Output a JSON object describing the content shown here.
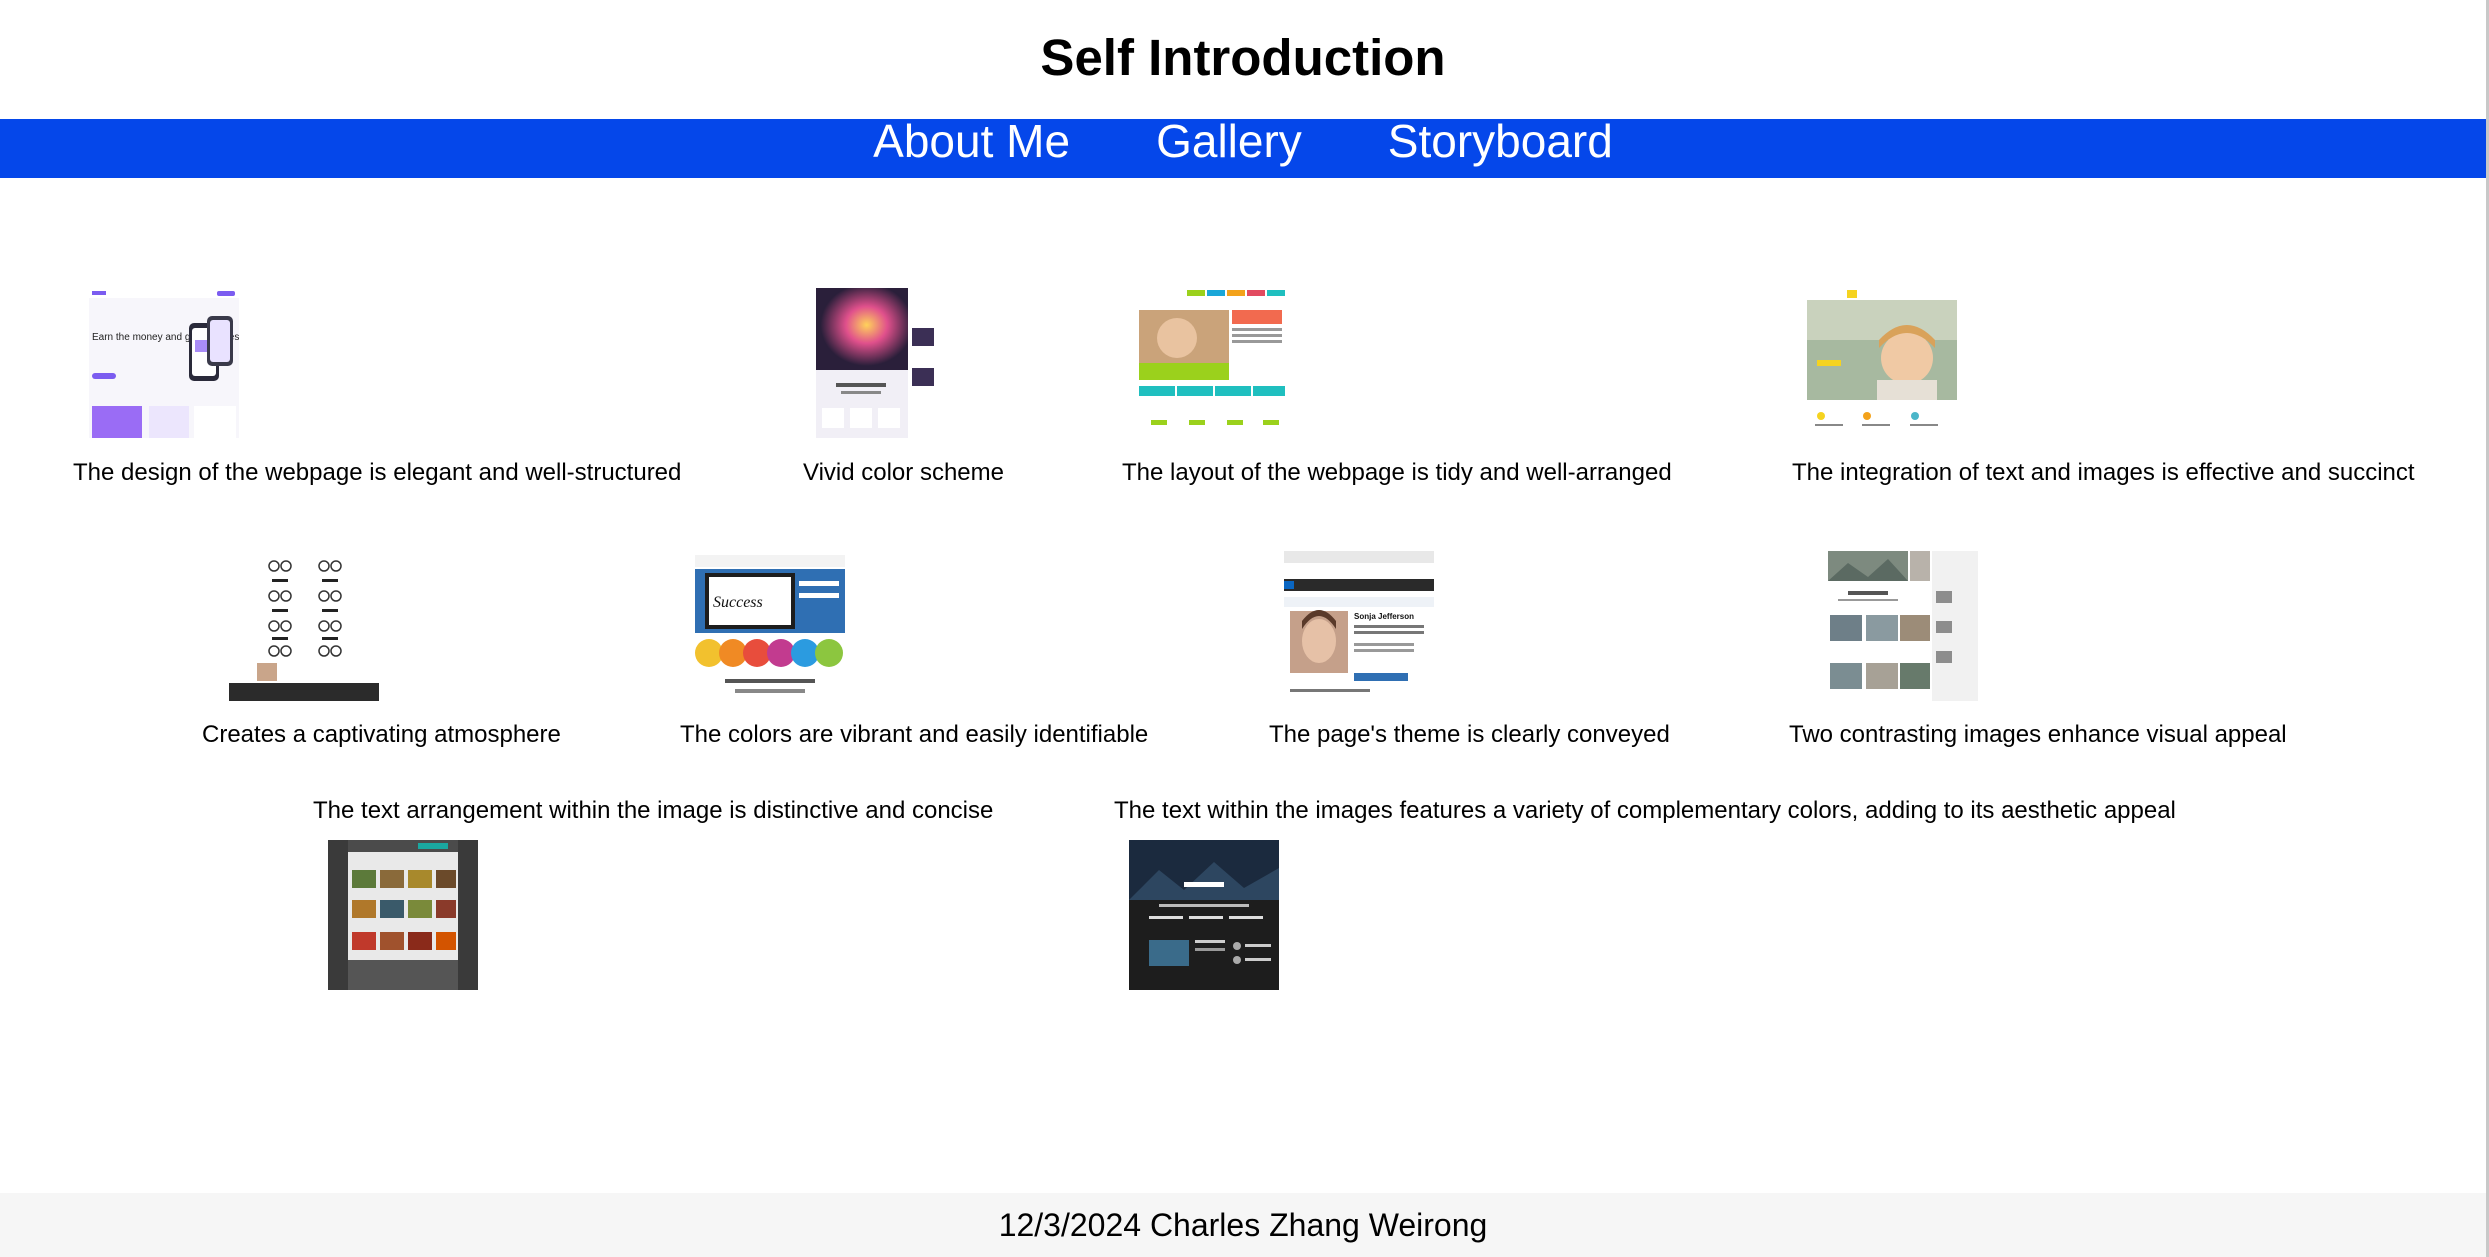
{
  "header": {
    "title": "Self Introduction"
  },
  "nav": {
    "items": [
      "About Me",
      "Gallery",
      "Storyboard"
    ]
  },
  "gallery": {
    "captions": [
      "The design of the webpage is elegant and well-structured",
      "Vivid color scheme",
      "The layout of the webpage is tidy and well-arranged",
      "The integration of text and images is effective and succinct",
      "Creates a captivating atmosphere",
      "The colors are vibrant and easily identifiable",
      "The page's theme is clearly conveyed",
      "Two contrasting images enhance visual appeal",
      "The text arrangement within the image is distinctive and concise",
      "The text within the images features a variety of complementary colors, adding to its aesthetic appeal"
    ],
    "thumb_texts": {
      "t1": "Earn the money and get bonuses!",
      "t6": "Success",
      "t7": "Sonja Jefferson"
    }
  },
  "footer": {
    "text": "12/3/2024 Charles Zhang Weirong"
  }
}
